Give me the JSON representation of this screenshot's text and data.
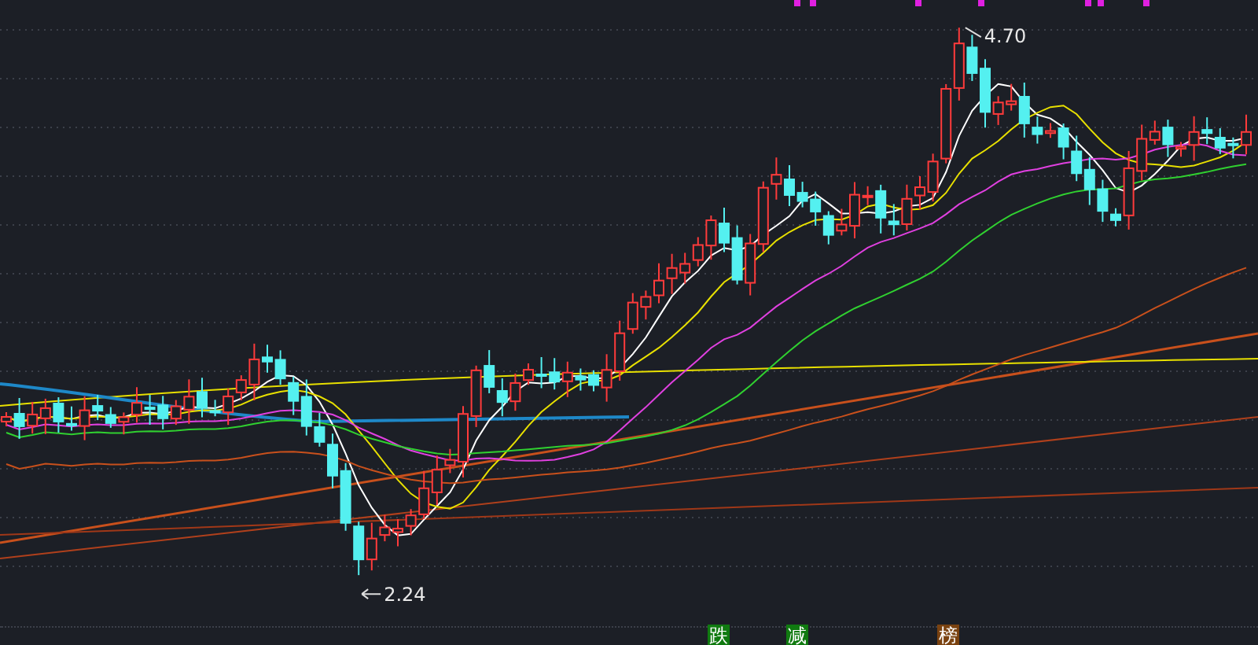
{
  "chart": {
    "high_label": "4.70",
    "low_label": "2.24"
  },
  "signals": [
    {
      "label": "跌",
      "color": "#107a10"
    },
    {
      "label": "减",
      "color": "#107a10"
    },
    {
      "label": "榜",
      "color": "#7a4210"
    }
  ]
}
